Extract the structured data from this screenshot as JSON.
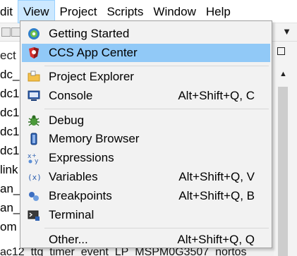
{
  "menubar": {
    "items": [
      {
        "label": "dit"
      },
      {
        "label": "View"
      },
      {
        "label": "Project"
      },
      {
        "label": "Scripts"
      },
      {
        "label": "Window"
      },
      {
        "label": "Help"
      }
    ]
  },
  "left_pane": {
    "rows": [
      "ect",
      "dc_",
      "dc1",
      "dc1",
      "dc1",
      "dc1",
      "link",
      "an_",
      "an_",
      "om"
    ]
  },
  "bottom_strip": {
    "text": "ac12_ttg_timer_event_LP_MSPM0G3507_nortos"
  },
  "view_menu": {
    "items": [
      {
        "label": "Getting Started",
        "shortcut": "",
        "icon": "getting-started-icon"
      },
      {
        "label": "CCS App Center",
        "shortcut": "",
        "icon": "app-center-icon",
        "highlighted": true
      },
      {
        "label": "Project Explorer",
        "shortcut": "",
        "icon": "folder-icon"
      },
      {
        "label": "Console",
        "shortcut": "Alt+Shift+Q, C",
        "icon": "console-icon"
      },
      {
        "label": "Debug",
        "shortcut": "",
        "icon": "debug-icon"
      },
      {
        "label": "Memory Browser",
        "shortcut": "",
        "icon": "memory-icon"
      },
      {
        "label": "Expressions",
        "shortcut": "",
        "icon": "expressions-icon"
      },
      {
        "label": "Variables",
        "shortcut": "Alt+Shift+Q, V",
        "icon": "variables-icon"
      },
      {
        "label": "Breakpoints",
        "shortcut": "Alt+Shift+Q, B",
        "icon": "breakpoints-icon"
      },
      {
        "label": "Terminal",
        "shortcut": "",
        "icon": "terminal-icon"
      },
      {
        "label": "Other...",
        "shortcut": "Alt+Shift+Q, Q",
        "icon": ""
      }
    ]
  },
  "colors": {
    "highlight": "#91c9f7",
    "menubar_active": "#cce8ff",
    "menu_bg": "#f2f2f2"
  }
}
